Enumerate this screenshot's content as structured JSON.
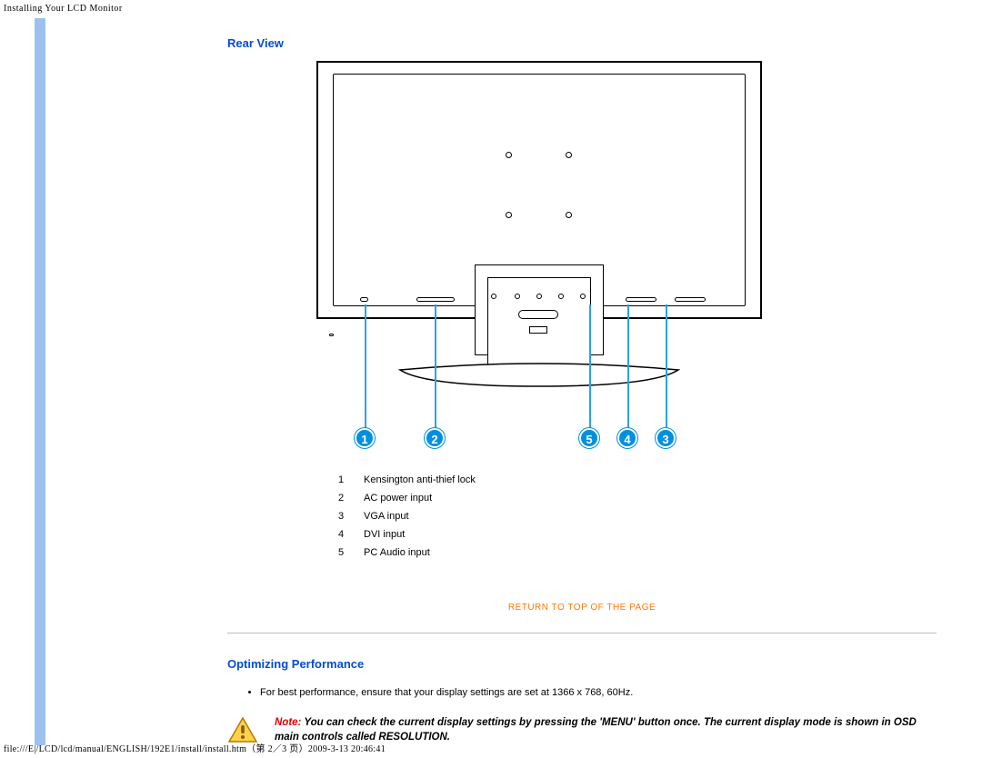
{
  "page_header": "Installing Your LCD Monitor",
  "sections": {
    "rear_view": {
      "title": "Rear View",
      "callouts": [
        {
          "n": "1"
        },
        {
          "n": "2"
        },
        {
          "n": "5"
        },
        {
          "n": "4"
        },
        {
          "n": "3"
        }
      ],
      "legend": [
        {
          "n": "1",
          "label": "Kensington anti-thief lock"
        },
        {
          "n": "2",
          "label": "AC power input"
        },
        {
          "n": "3",
          "label": "VGA input"
        },
        {
          "n": "4",
          "label": "DVI input"
        },
        {
          "n": "5",
          "label": "PC Audio  input"
        }
      ]
    },
    "return_link": "RETURN TO TOP OF THE PAGE",
    "optimizing": {
      "title": "Optimizing Performance",
      "bullet": "For best performance, ensure that your display settings are set at 1366 x 768, 60Hz.",
      "note_prefix": "Note:",
      "note_body": " You can check the current display settings by pressing the 'MENU' button once. The current display mode is shown in OSD main controls called RESOLUTION."
    }
  },
  "footer_path": "file:///E|/LCD/lcd/manual/ENGLISH/192E1/install/install.htm（第 2／3 页）2009-3-13 20:46:41"
}
